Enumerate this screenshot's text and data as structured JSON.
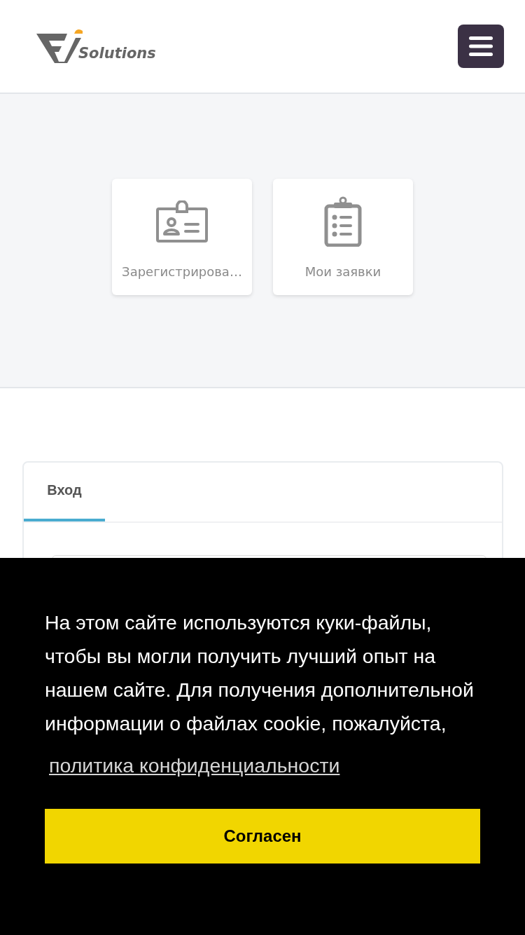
{
  "header": {
    "logo_text": "Solutions"
  },
  "tiles": [
    {
      "kind": "badge",
      "label": "Зарегистрирова…"
    },
    {
      "kind": "clipboard",
      "label": "Мои заявки"
    }
  ],
  "login_card": {
    "tabs": [
      {
        "label": "Вход",
        "selected": true
      }
    ]
  },
  "cookie_banner": {
    "message": "На этом сайте используются куки-файлы, чтобы вы могли получить лучший опыт на нашем сайте. Для получения дополнительной информации о файлах cookie, пожалуйста,",
    "link": "политика конфиденциальности",
    "button": "Согласен"
  }
}
